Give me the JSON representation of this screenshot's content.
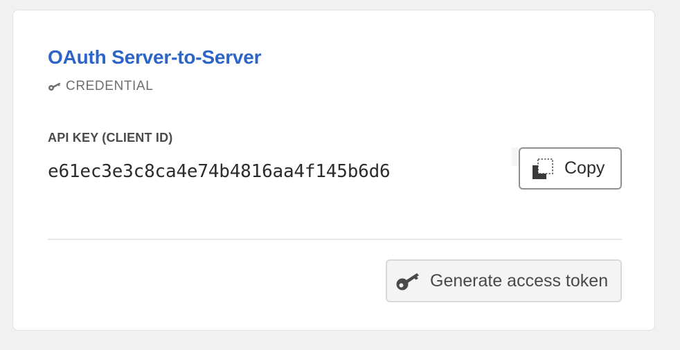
{
  "credential": {
    "title": "OAuth Server-to-Server",
    "type_label": "CREDENTIAL",
    "type_icon": "key-icon",
    "api_key_label": "API KEY (CLIENT ID)",
    "api_key_value": "e61ec3e3c8ca4e74b4816aa4f145b6d6"
  },
  "actions": {
    "copy_label": "Copy",
    "copy_icon": "copy-icon",
    "generate_label": "Generate access token",
    "generate_icon": "key-icon"
  },
  "colors": {
    "accent": "#2c65c7",
    "background": "#f1f1f1",
    "card": "#ffffff"
  }
}
